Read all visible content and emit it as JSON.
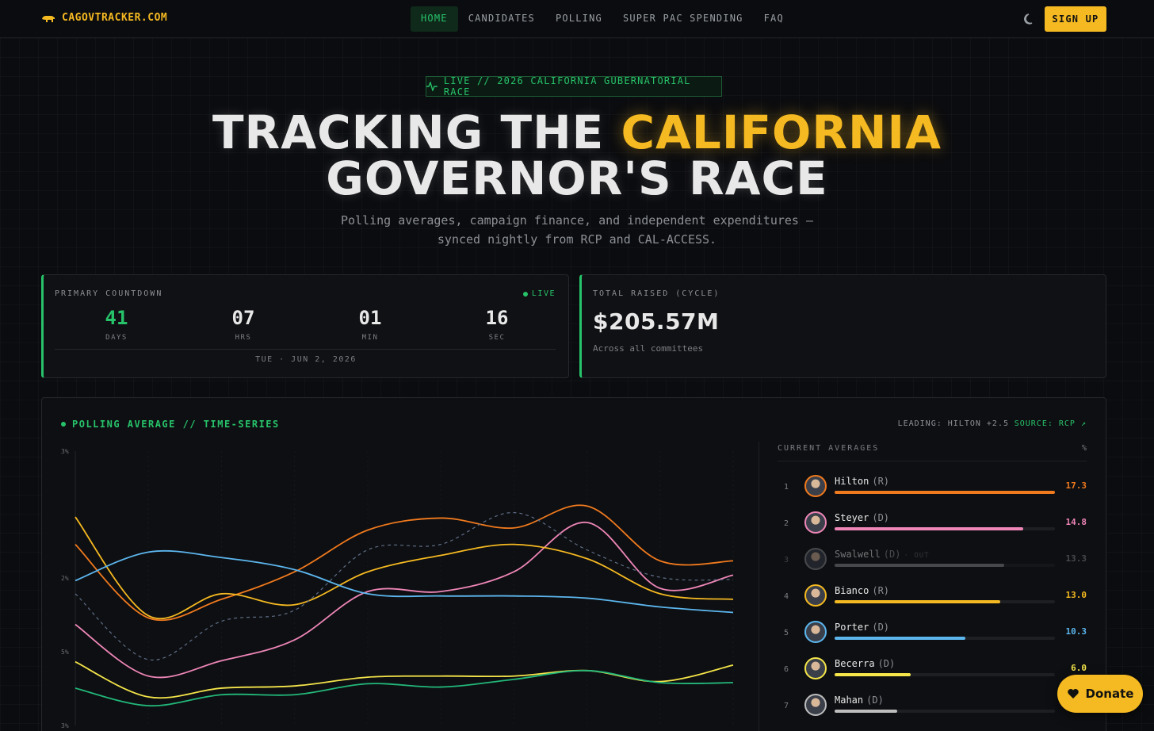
{
  "brand": {
    "name": "CAGOVTRACKER.COM"
  },
  "nav": {
    "links": [
      "HOME",
      "CANDIDATES",
      "POLLING",
      "SUPER PAC SPENDING",
      "FAQ"
    ],
    "active": "HOME",
    "signup_label": "SIGN UP"
  },
  "hero": {
    "pill": "LIVE // 2026 CALIFORNIA GUBERNATORIAL RACE",
    "title_part1": "TRACKING THE ",
    "title_accent": "CALIFORNIA",
    "title_part2": "GOVERNOR'S RACE",
    "subtitle": "Polling averages, campaign finance, and independent expenditures — synced nightly from RCP and CAL-ACCESS."
  },
  "countdown": {
    "label": "PRIMARY COUNTDOWN",
    "live": "LIVE",
    "units": [
      {
        "value": "41",
        "label": "DAYS"
      },
      {
        "value": "07",
        "label": "HRS"
      },
      {
        "value": "01",
        "label": "MIN"
      },
      {
        "value": "16",
        "label": "SEC"
      }
    ],
    "date": "TUE · JUN 2, 2026"
  },
  "raised": {
    "label": "TOTAL RAISED (CYCLE)",
    "value": "$205.57M",
    "sub": "Across all committees"
  },
  "polling": {
    "title": "POLLING AVERAGE // TIME-SERIES",
    "leading": "LEADING: HILTON +2.5",
    "source": "SOURCE: RCP ↗",
    "averages_label": "CURRENT AVERAGES",
    "pct_label": "%",
    "candidates": [
      {
        "rank": "1",
        "name": "Hilton",
        "party": "(R)",
        "out": "",
        "value": 17.3,
        "value_text": "17.3",
        "color": "#f07a1e"
      },
      {
        "rank": "2",
        "name": "Steyer",
        "party": "(D)",
        "out": "",
        "value": 14.8,
        "value_text": "14.8",
        "color": "#ee86b8"
      },
      {
        "rank": "3",
        "name": "Swalwell",
        "party": "(D)",
        "out": "· OUT",
        "value": 13.3,
        "value_text": "13.3",
        "color": "#8a8d92"
      },
      {
        "rank": "4",
        "name": "Bianco",
        "party": "(R)",
        "out": "",
        "value": 13.0,
        "value_text": "13.0",
        "color": "#f5b921"
      },
      {
        "rank": "5",
        "name": "Porter",
        "party": "(D)",
        "out": "",
        "value": 10.3,
        "value_text": "10.3",
        "color": "#5cb6ee"
      },
      {
        "rank": "6",
        "name": "Becerra",
        "party": "(D)",
        "out": "",
        "value": 6.0,
        "value_text": "6.0",
        "color": "#f4e54a"
      },
      {
        "rank": "7",
        "name": "Mahan",
        "party": "(D)",
        "out": "",
        "value": 4.9,
        "value_text": "",
        "color": "#bdbdbd"
      }
    ]
  },
  "chart_data": {
    "type": "line",
    "title": "POLLING AVERAGE // TIME-SERIES",
    "y_tick_labels": [
      "3%",
      "2%",
      "5%",
      "3%"
    ],
    "grid": true,
    "series": [
      {
        "name": "Hilton",
        "color": "#f07a1e",
        "values": [
          16.5,
          9.8,
          11.5,
          14.0,
          17.8,
          18.9,
          18.0,
          20.0,
          15.0,
          15.0
        ]
      },
      {
        "name": "Steyer",
        "color": "#ee86b8",
        "values": [
          9.2,
          4.5,
          5.9,
          7.8,
          12.2,
          12.2,
          14.0,
          18.5,
          12.5,
          13.7
        ]
      },
      {
        "name": "Bianco",
        "color": "#f5b921",
        "values": [
          19.0,
          10.0,
          12.0,
          11.0,
          14.0,
          15.5,
          16.5,
          15.2,
          12.0,
          11.5
        ]
      },
      {
        "name": "Porter",
        "color": "#5cb6ee",
        "values": [
          13.2,
          15.8,
          15.3,
          14.2,
          12.0,
          11.8,
          11.8,
          11.6,
          10.8,
          10.3
        ]
      },
      {
        "name": "Becerra",
        "color": "#f4e54a",
        "values": [
          5.8,
          2.6,
          3.4,
          3.6,
          4.4,
          4.5,
          4.5,
          5.0,
          4.0,
          5.5
        ]
      },
      {
        "name": "Mahan",
        "color": "#22b87a",
        "values": [
          3.4,
          1.8,
          2.8,
          2.8,
          3.8,
          3.5,
          4.2,
          5.0,
          3.9,
          3.9
        ]
      },
      {
        "name": "Swalwell",
        "color": "#5e6f88",
        "values": [
          12.0,
          6.0,
          9.5,
          10.5,
          16.0,
          16.5,
          19.4,
          16.0,
          13.5,
          13.3
        ]
      }
    ]
  },
  "donate": {
    "label": "Donate"
  }
}
